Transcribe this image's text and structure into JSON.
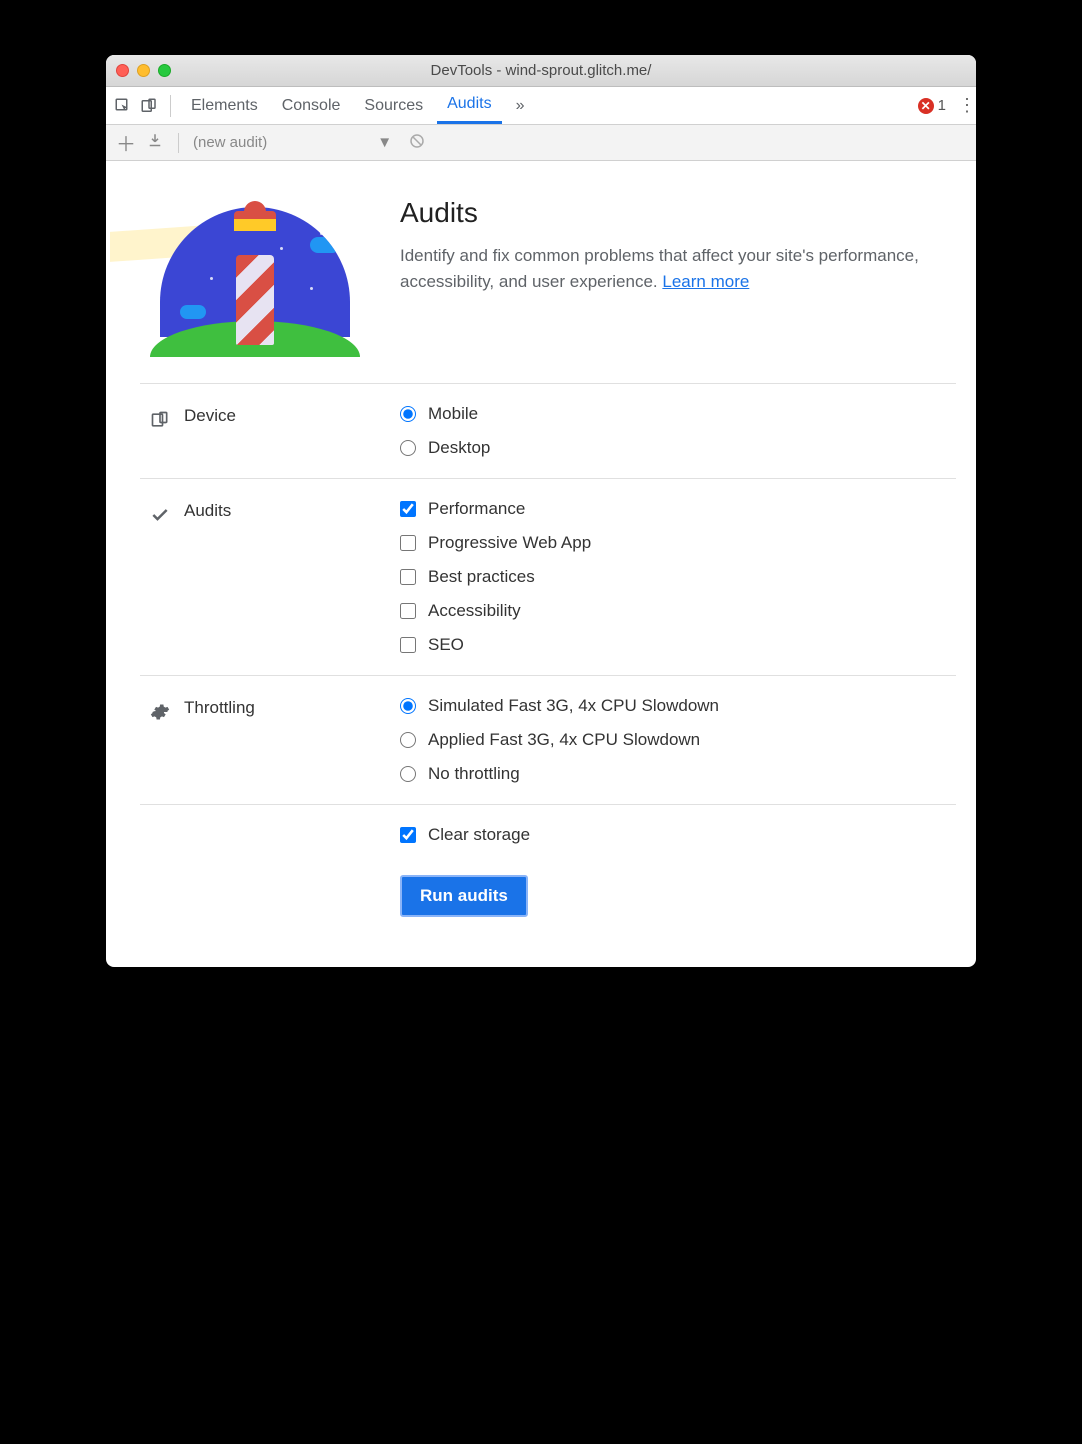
{
  "window": {
    "title": "DevTools - wind-sprout.glitch.me/"
  },
  "tabs": {
    "elements": "Elements",
    "console": "Console",
    "sources": "Sources",
    "audits": "Audits",
    "more": "»"
  },
  "errors": {
    "count": "1"
  },
  "toolbar": {
    "new_audit": "(new audit)"
  },
  "hero": {
    "title": "Audits",
    "desc": "Identify and fix common problems that affect your site's performance, accessibility, and user experience. ",
    "learn_more": "Learn more"
  },
  "sections": {
    "device": {
      "label": "Device",
      "mobile": "Mobile",
      "desktop": "Desktop"
    },
    "audits": {
      "label": "Audits",
      "performance": "Performance",
      "pwa": "Progressive Web App",
      "best": "Best practices",
      "a11y": "Accessibility",
      "seo": "SEO"
    },
    "throttling": {
      "label": "Throttling",
      "sim": "Simulated Fast 3G, 4x CPU Slowdown",
      "app": "Applied Fast 3G, 4x CPU Slowdown",
      "none": "No throttling"
    },
    "clear_storage": "Clear storage"
  },
  "run_button": "Run audits"
}
